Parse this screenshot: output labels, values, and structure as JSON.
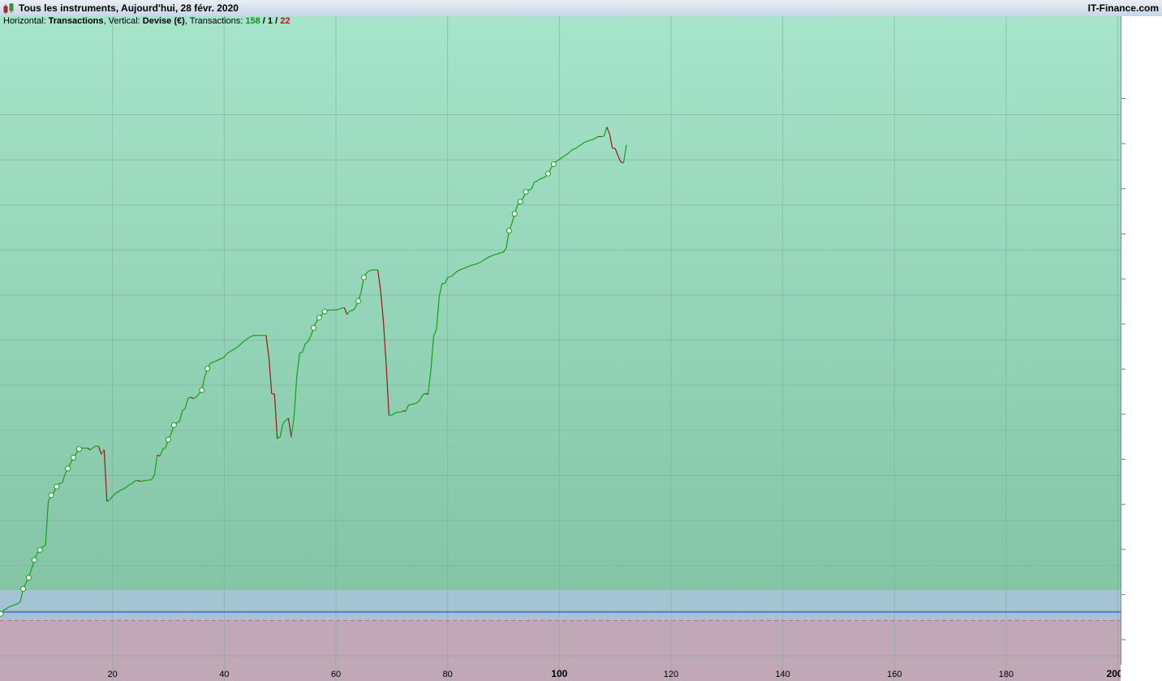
{
  "header": {
    "title": "Tous les instruments, Aujourd'hui, 28 févr. 2020",
    "brand": "IT-Finance.com",
    "icon": "candlestick-chart-icon"
  },
  "info": {
    "horizontal_label": "Horizontal: ",
    "horizontal_value": "Transactions",
    "vertical_label": ", Vertical: ",
    "vertical_value": "Devise (€)",
    "transactions_label": ", Transactions: ",
    "wins": "158",
    "sep1": " / ",
    "even": "1",
    "sep2": " / ",
    "losses": "22"
  },
  "colors": {
    "profit_zone_top": "#a6e4cb",
    "profit_zone_bottom": "#84c5a6",
    "loss_zone": "#a5c4d3",
    "below_zone": "#c0a8b6",
    "up_line": "#15a015",
    "down_line": "#a01515",
    "zero_line": "#1f3bd6",
    "marker_fill": "#ffffff"
  },
  "chart_data": {
    "type": "line",
    "xlabel": "",
    "ylabel": "",
    "xlim": [
      0,
      200
    ],
    "ylim": [
      -5,
      115
    ],
    "x_ticks": [
      "20",
      "40",
      "60",
      "80",
      "100",
      "120",
      "140",
      "160",
      "180",
      "200"
    ],
    "bold_x_ticks": [
      "100",
      "200"
    ],
    "zero_level": 0,
    "loss_zone_top": 10,
    "y_values": [
      -0.8,
      0.8,
      1.6,
      2.4,
      2.9,
      3.3,
      3.8,
      4.7,
      10.6,
      13.3,
      15.7,
      19.6,
      23.8,
      26.8,
      28.4,
      29.8,
      30.5,
      50.4,
      53.4,
      54.7,
      57.3,
      58.8,
      59.0,
      63.0,
      65.6,
      68.1,
      70.6,
      72.4,
      74.5,
      74.9,
      74.9,
      74.9,
      74.1,
      75.1,
      75.8,
      75.8,
      72.0,
      74.2,
      50.5,
      51.4,
      52.9,
      54.1,
      54.9,
      55.8,
      56.3,
      57.1,
      58.2,
      58.7,
      59.9,
      60.2,
      59.7,
      59.9,
      60.2,
      60.3,
      60.5,
      62.6,
      71.7,
      71.3,
      74.5,
      75.1,
      78.8,
      81.5,
      85.4,
      86.4,
      87.1,
      92.0,
      92.9,
      97.6,
      98.2,
      97.5,
      98.4,
      99.8,
      101.4,
      107.4,
      111.2,
      113.6,
      114.2,
      114.6,
      115.3,
      115.9,
      116.5,
      118.1,
      119.0,
      119.7,
      120.5,
      121.3,
      122.5,
      123.7,
      124.6,
      125.4,
      126.2,
      126.4,
      126.4,
      126.4,
      126.4,
      126.4,
      116.3,
      99.8,
      99.6,
      79.2,
      80.0,
      86.0,
      87.6,
      88.6,
      79.9,
      89.1,
      107.7,
      118.3,
      118.8,
      122.5,
      123.6,
      126.1,
      129.8,
      132.6,
      134.5,
      135.9,
      137.3,
      137.9,
      138.0,
      138.0,
      138.0,
      138.4,
      138.8,
      139.1,
      135.9,
      137.6,
      137.8,
      139.2,
      142.1,
      146.1,
      152.9,
      154.9,
      156.0,
      156.3,
      156.3,
      156.3,
      146.9,
      132.8,
      113.3,
      89.9,
      90.0,
      90.8,
      91.3,
      91.3,
      91.9,
      91.8,
      94.6,
      94.9,
      95.1,
      95.6,
      96.8,
      99.1,
      99.9,
      99.4,
      110.6,
      126.1,
      129.0,
      144.2,
      150.1,
      150.1,
      152.8,
      153.2,
      154.0,
      155.3,
      156.1,
      156.7,
      157.1,
      157.6,
      158.2,
      158.6,
      158.9,
      159.4,
      160.0,
      160.9,
      161.6,
      162.4,
      162.8,
      163.3,
      163.7,
      164.2,
      164.4,
      166.4,
      174.2,
      177.5,
      182.0,
      185.8,
      187.5,
      189.1,
      192.0,
      192.8,
      193.3,
      196.4,
      196.9,
      197.8,
      198.2,
      198.9,
      200.3,
      202.8,
      204.6,
      206.0,
      206.8,
      207.7,
      208.5,
      209.4,
      210.5,
      211.4,
      211.9,
      212.9,
      213.7,
      214.7,
      215.0,
      215.6,
      215.9,
      216.6,
      217.3,
      217.2,
      217.4,
      221.6,
      218.4,
      212.0,
      211.8,
      208.5,
      205.7,
      205.2,
      213.4
    ],
    "markers_note": "circle marker on each new equity high",
    "vertical_axis_labels_visible": false
  }
}
